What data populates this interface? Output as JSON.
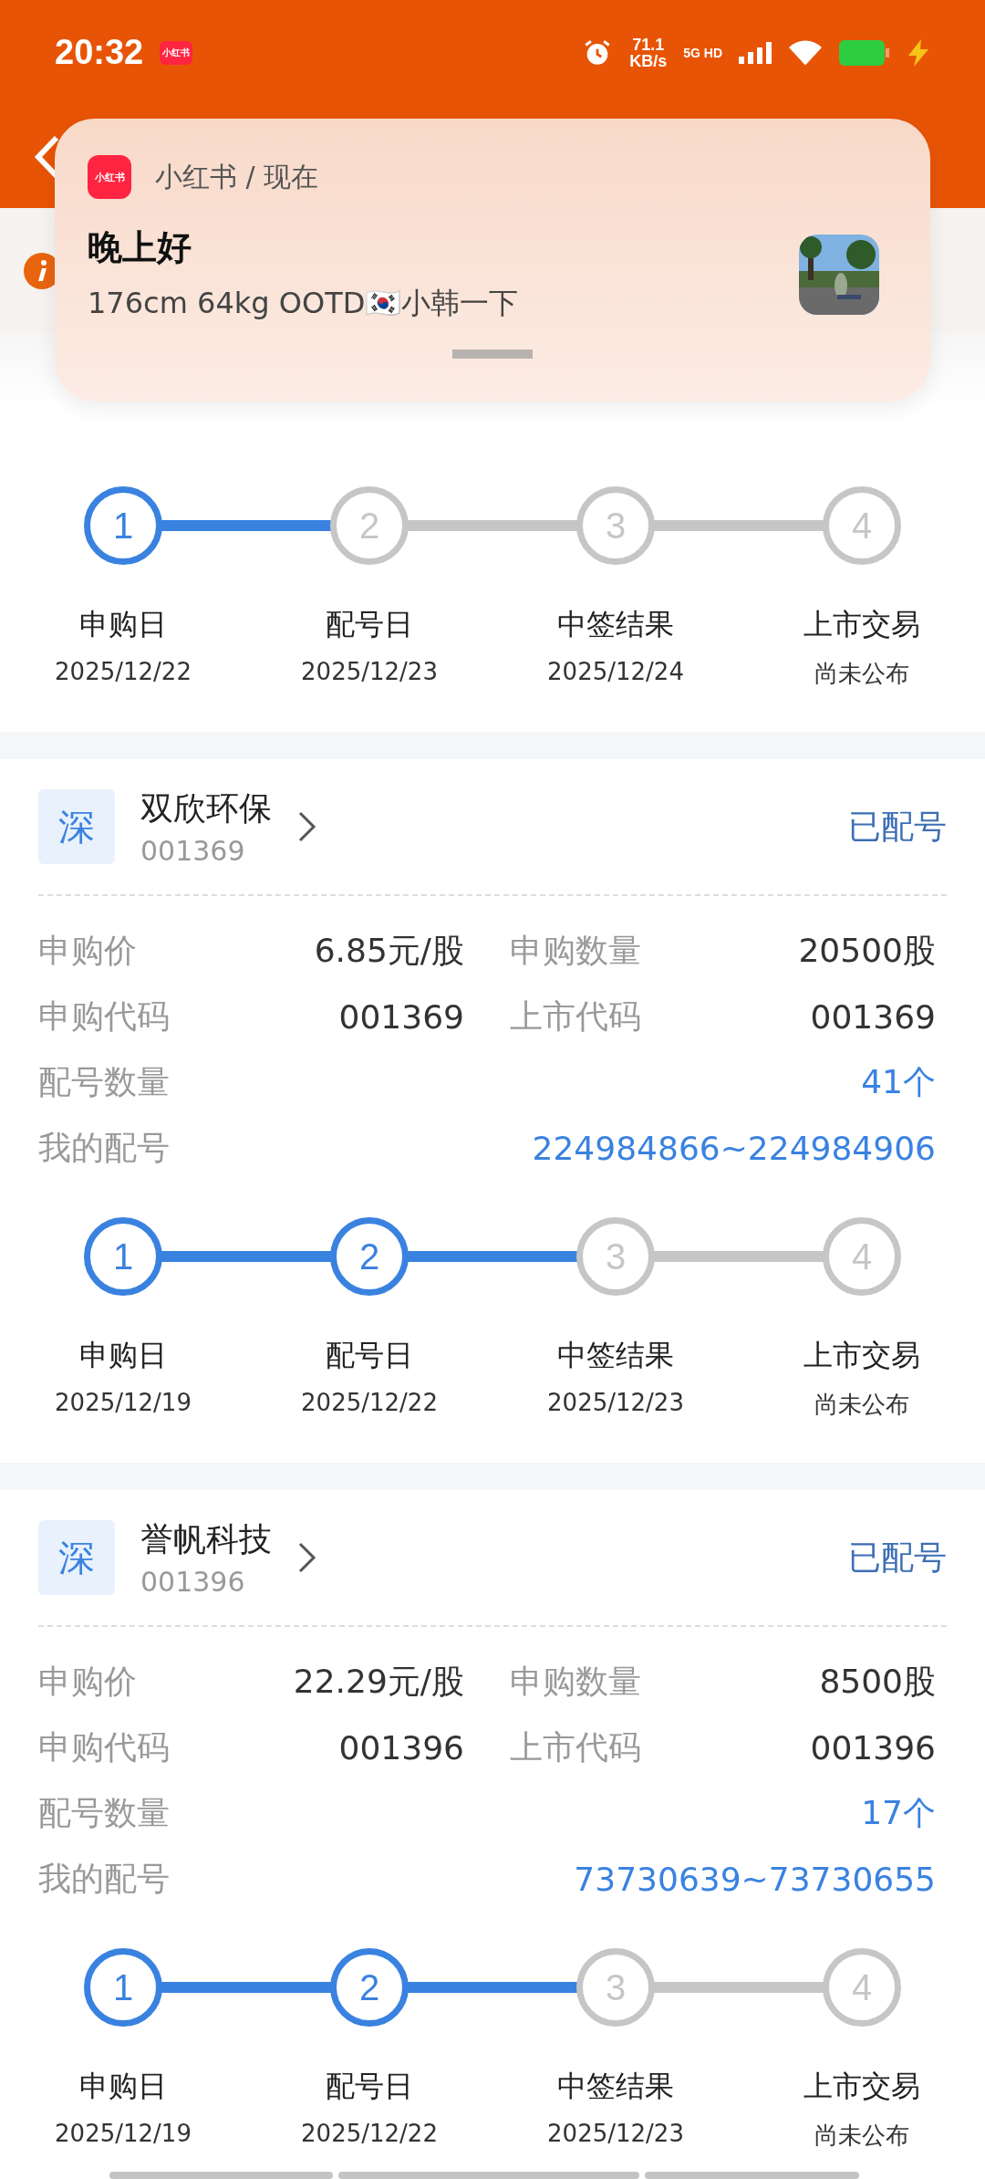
{
  "status_bar": {
    "time": "20:32",
    "app_badge": "小红书",
    "speed": "71.1",
    "speed_unit": "KB/s",
    "network": "5G HD"
  },
  "notification": {
    "app_icon": "小红书",
    "source": "小红书 / 现在",
    "title": "晚上好",
    "body": "176cm 64kg OOTD🇰🇷小韩一下"
  },
  "current_steps": [
    {
      "number": "1",
      "label": "申购日",
      "date": "2025/12/22",
      "done": true
    },
    {
      "number": "2",
      "label": "配号日",
      "date": "2025/12/23",
      "done": false
    },
    {
      "number": "3",
      "label": "中签结果",
      "date": "2025/12/24",
      "done": false
    },
    {
      "number": "4",
      "label": "上市交易",
      "date": "尚未公布",
      "done": false
    }
  ],
  "records": [
    {
      "exchange": "深",
      "name": "双欣环保",
      "code": "001369",
      "status": "已配号",
      "rows": [
        {
          "cells": [
            {
              "label": "申购价",
              "value": "6.85元/股",
              "highlight": false
            },
            {
              "label": "申购数量",
              "value": "20500股",
              "highlight": false
            }
          ]
        },
        {
          "cells": [
            {
              "label": "申购代码",
              "value": "001369",
              "highlight": false
            },
            {
              "label": "上市代码",
              "value": "001369",
              "highlight": false
            }
          ]
        },
        {
          "cells": [
            {
              "label": "配号数量",
              "value": "41个",
              "highlight": true
            }
          ]
        },
        {
          "cells": [
            {
              "label": "我的配号",
              "value": "224984866~224984906",
              "highlight": true
            }
          ]
        }
      ],
      "steps": [
        {
          "number": "1",
          "label": "申购日",
          "date": "2025/12/19",
          "done": true
        },
        {
          "number": "2",
          "label": "配号日",
          "date": "2025/12/22",
          "done": true
        },
        {
          "number": "3",
          "label": "中签结果",
          "date": "2025/12/23",
          "done": false
        },
        {
          "number": "4",
          "label": "上市交易",
          "date": "尚未公布",
          "done": false
        }
      ]
    },
    {
      "exchange": "深",
      "name": "誉帆科技",
      "code": "001396",
      "status": "已配号",
      "rows": [
        {
          "cells": [
            {
              "label": "申购价",
              "value": "22.29元/股",
              "highlight": false
            },
            {
              "label": "申购数量",
              "value": "8500股",
              "highlight": false
            }
          ]
        },
        {
          "cells": [
            {
              "label": "申购代码",
              "value": "001396",
              "highlight": false
            },
            {
              "label": "上市代码",
              "value": "001396",
              "highlight": false
            }
          ]
        },
        {
          "cells": [
            {
              "label": "配号数量",
              "value": "17个",
              "highlight": true
            }
          ]
        },
        {
          "cells": [
            {
              "label": "我的配号",
              "value": "73730639~73730655",
              "highlight": true
            }
          ]
        }
      ],
      "steps": [
        {
          "number": "1",
          "label": "申购日",
          "date": "2025/12/19",
          "done": true
        },
        {
          "number": "2",
          "label": "配号日",
          "date": "2025/12/22",
          "done": true
        },
        {
          "number": "3",
          "label": "中签结果",
          "date": "2025/12/23",
          "done": false
        },
        {
          "number": "4",
          "label": "上市交易",
          "date": "尚未公布",
          "done": false
        }
      ]
    }
  ]
}
